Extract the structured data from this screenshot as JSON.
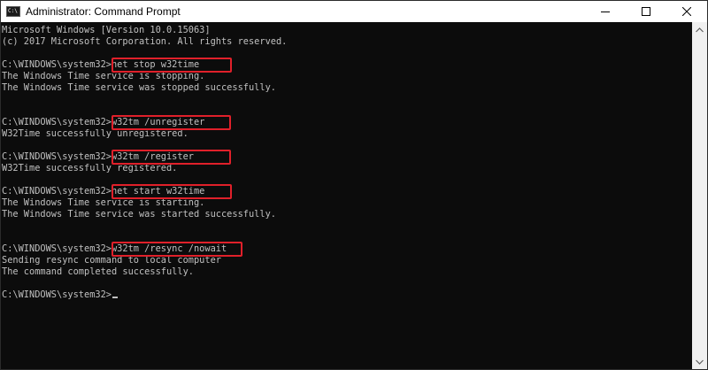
{
  "window": {
    "title": "Administrator: Command Prompt",
    "app_icon_text": "C:\\",
    "controls": [
      "minimize-icon",
      "maximize-icon",
      "close-icon"
    ]
  },
  "console": {
    "lines": [
      "Microsoft Windows [Version 10.0.15063]",
      "(c) 2017 Microsoft Corporation. All rights reserved.",
      "",
      "C:\\WINDOWS\\system32>net stop w32time",
      "The Windows Time service is stopping.",
      "The Windows Time service was stopped successfully.",
      "",
      "",
      "C:\\WINDOWS\\system32>w32tm /unregister",
      "W32Time successfully unregistered.",
      "",
      "C:\\WINDOWS\\system32>w32tm /register",
      "W32Time successfully registered.",
      "",
      "C:\\WINDOWS\\system32>net start w32time",
      "The Windows Time service is starting.",
      "The Windows Time service was started successfully.",
      "",
      "",
      "C:\\WINDOWS\\system32>w32tm /resync /nowait",
      "Sending resync command to local computer",
      "The command completed successfully.",
      "",
      "C:\\WINDOWS\\system32>"
    ],
    "highlighted_commands": [
      "net stop w32time",
      "w32tm /unregister",
      "w32tm /register",
      "net start w32time",
      "w32tm /resync /nowait"
    ]
  },
  "colors": {
    "console_bg": "#0c0c0c",
    "console_text": "#c0c0c0",
    "highlight_border": "#e0202a",
    "titlebar_bg": "#ffffff"
  }
}
